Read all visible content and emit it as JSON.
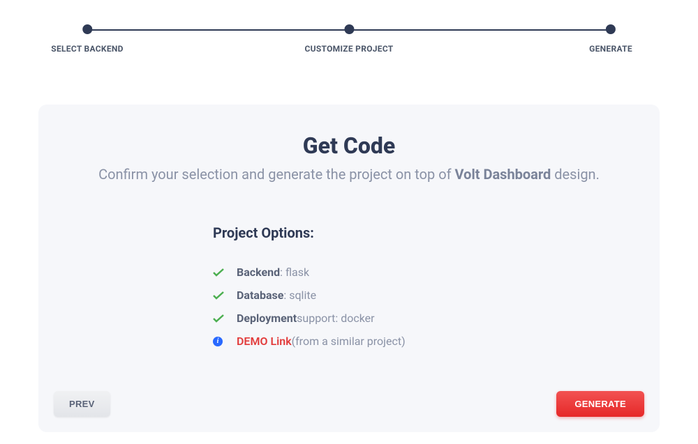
{
  "stepper": {
    "steps": [
      {
        "label": "SELECT BACKEND"
      },
      {
        "label": "CUSTOMIZE PROJECT"
      },
      {
        "label": "GENERATE"
      }
    ]
  },
  "card": {
    "title": "Get Code",
    "subtitle_prefix": "Confirm your selection and generate the project on top of ",
    "subtitle_strong": "Volt Dashboard",
    "subtitle_suffix": " design."
  },
  "options": {
    "title": "Project Options:",
    "items": [
      {
        "label": "Backend",
        "value": ": flask"
      },
      {
        "label": "Database",
        "value": ": sqlite"
      },
      {
        "label": "Deployment",
        "value": " support: docker"
      }
    ],
    "demo": {
      "link_text": "DEMO Link",
      "hint": " (from a similar project)",
      "info_glyph": "i"
    }
  },
  "buttons": {
    "prev": "PREV",
    "generate": "GENERATE"
  }
}
